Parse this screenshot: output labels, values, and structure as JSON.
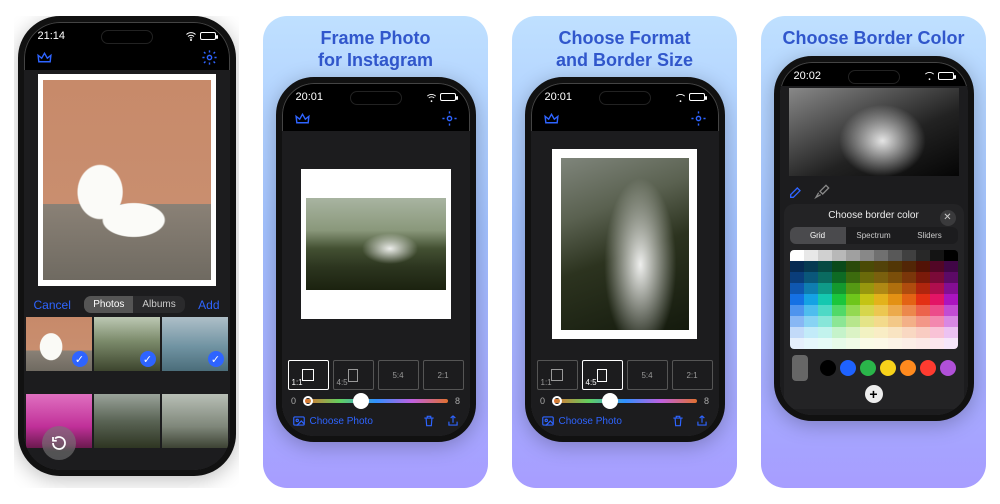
{
  "panel1": {
    "time": "21:14",
    "picker": {
      "cancel": "Cancel",
      "add": "Add",
      "segments": [
        "Photos",
        "Albums"
      ],
      "selected": 0
    },
    "thumbs_selected": [
      0,
      1,
      2
    ]
  },
  "panel2": {
    "title": "Frame Photo\nfor Instagram",
    "time": "20:01",
    "formats": [
      "1:1",
      "4:5",
      "5:4",
      "2:1"
    ],
    "format_selected": 0,
    "slider": {
      "min": "0",
      "max": "8",
      "value": 0.4
    },
    "choose": "Choose Photo"
  },
  "panel3": {
    "title": "Choose Format\nand Border Size",
    "time": "20:01",
    "formats": [
      "1:1",
      "4:5",
      "5:4",
      "2:1"
    ],
    "format_selected": 1,
    "slider": {
      "min": "0",
      "max": "8",
      "value": 0.4
    },
    "choose": "Choose Photo"
  },
  "panel4": {
    "title": "Choose Border Color",
    "time": "20:02",
    "sheet_title": "Choose border color",
    "tabs": [
      "Grid",
      "Spectrum",
      "Sliders"
    ],
    "tab_selected": 0,
    "preset_colors": [
      "#000000",
      "#1e62ff",
      "#2ab54a",
      "#f7d21a",
      "#ff8a1e",
      "#ff3b30",
      "#b050d8"
    ],
    "grid_rows": [
      [
        "#ffffff",
        "#e8e8e8",
        "#d0d0d0",
        "#b8b8b8",
        "#a0a0a0",
        "#888888",
        "#707070",
        "#585858",
        "#404040",
        "#282828",
        "#141414",
        "#000000"
      ],
      [
        "#062a52",
        "#063a52",
        "#064a42",
        "#0a4a1a",
        "#2a4a0a",
        "#4a4a06",
        "#52420a",
        "#523606",
        "#522606",
        "#521206",
        "#520626",
        "#400646"
      ],
      [
        "#0a3d7a",
        "#0a577a",
        "#0a6b60",
        "#0e6b24",
        "#3c6b0e",
        "#6a6a0a",
        "#7a600e",
        "#7a4e0a",
        "#7a360a",
        "#7a1a0a",
        "#7a0a38",
        "#5c0a66"
      ],
      [
        "#0f57b0",
        "#0f7db0",
        "#0f9a88",
        "#14992e",
        "#559914",
        "#97970e",
        "#af8914",
        "#af6f0e",
        "#af4c0e",
        "#af250e",
        "#af0e4e",
        "#840e93"
      ],
      [
        "#1571e4",
        "#15a2e4",
        "#15c8b0",
        "#1bc63c",
        "#6ec61b",
        "#c4c414",
        "#e3b21b",
        "#e39114",
        "#e36314",
        "#e33014",
        "#e31466",
        "#ab14bf"
      ],
      [
        "#4e94ee",
        "#4ebdee",
        "#4ed9c6",
        "#51d968",
        "#93d951",
        "#d6d64c",
        "#ecc751",
        "#ecaa4c",
        "#ec884c",
        "#ec634c",
        "#ec4c8b",
        "#c24cd3"
      ],
      [
        "#88b7f4",
        "#88d3f4",
        "#88e6d9",
        "#8ce695",
        "#b7e68c",
        "#e4e488",
        "#f3da8c",
        "#f3c888",
        "#f3b088",
        "#f39788",
        "#f388af",
        "#d888e3"
      ],
      [
        "#c2daf9",
        "#c2ebf9",
        "#c2f3ed",
        "#c5f3ca",
        "#dbf3c5",
        "#f2f2c2",
        "#f9edc5",
        "#f9e4c2",
        "#f9d8c2",
        "#f9ccc2",
        "#f9c2d6",
        "#ecc2f2"
      ],
      [
        "#e6f0fc",
        "#e6f7fc",
        "#e6fbf7",
        "#e7fbe9",
        "#f0fbe7",
        "#fafae6",
        "#fcf8e7",
        "#fcf3e6",
        "#fceee6",
        "#fce9e6",
        "#fce6ee",
        "#f6e6fa"
      ]
    ]
  },
  "accent": "#2e64ff"
}
